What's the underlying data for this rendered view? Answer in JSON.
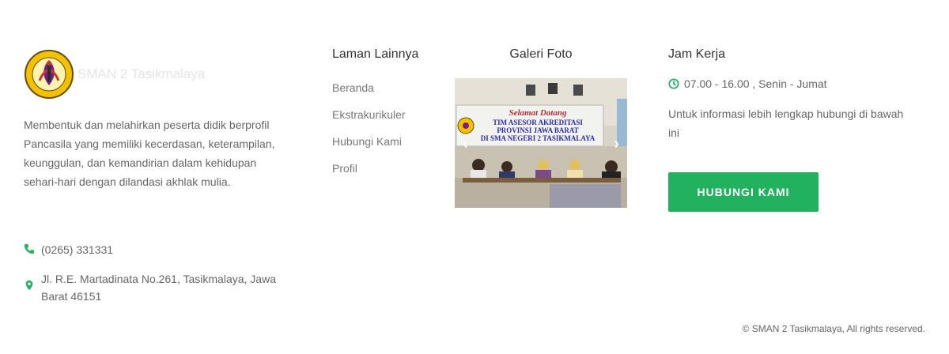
{
  "brand": {
    "name": "SMAN 2 Tasikmalaya",
    "description": "Membentuk dan melahirkan peserta didik berprofil Pancasila yang memiliki kecerdasan, keterampilan, keunggulan, dan kemandirian dalam kehidupan sehari-hari dengan dilandasi akhlak mulia.",
    "phone": "(0265) 331331",
    "address": "Jl. R.E. Martadinata No.261, Tasikmalaya, Jawa Barat 46151"
  },
  "links": {
    "title": "Laman Lainnya",
    "items": [
      "Beranda",
      "Ekstrakurikuler",
      "Hubungi Kami",
      "Profil"
    ]
  },
  "gallery": {
    "title": "Galeri Foto",
    "banner_line1": "Selamat Datang",
    "banner_line2": "TIM ASESOR AKREDITASI",
    "banner_line3": "PROVINSI JAWA BARAT",
    "banner_line4": "DI SMA NEGERI 2 TASIKMALAYA"
  },
  "hours": {
    "title": "Jam Kerja",
    "time": "07.00 - 16.00 , Senin - Jumat",
    "info": "Untuk informasi lebih lengkap hubungi di bawah ini",
    "button": "HUBUNGI KAMI"
  },
  "footer": {
    "copyright": "© SMAN 2 Tasikmalaya, All rights reserved."
  },
  "colors": {
    "accent": "#22b15f",
    "icon": "#22b15f"
  },
  "icons": {
    "phone": "phone-icon",
    "location": "map-marker-icon",
    "clock": "clock-icon"
  }
}
